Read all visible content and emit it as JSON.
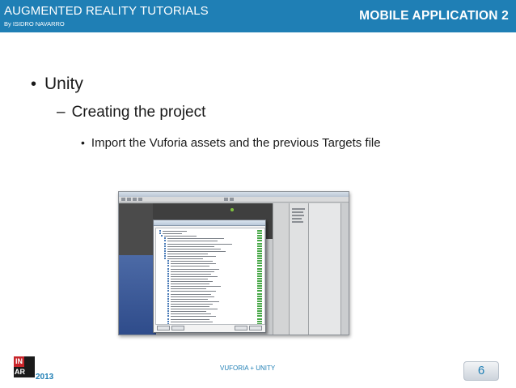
{
  "header": {
    "title": "AUGMENTED REALITY TUTORIALS",
    "author": "By ISIDRO NAVARRO",
    "section": "MOBILE APPLICATION 2",
    "background_color": "#1f7fb5",
    "text_color": "#ffffff"
  },
  "content": {
    "bullet_marker_level1": "•",
    "bullet_marker_level2": "–",
    "bullet_marker_level3": "•",
    "level1": "Unity",
    "level2": "Creating the project",
    "level3": "Import the Vuforia assets and the previous Targets file"
  },
  "screenshot": {
    "description_icon": "unity-editor-import-dialog-screenshot"
  },
  "footer": {
    "logo_top_left": "IN",
    "logo_bottom": "AR",
    "year": "2013",
    "center_text": "VUFORIA + UNITY",
    "page_number": "6",
    "accent_color": "#1f7fb5"
  }
}
